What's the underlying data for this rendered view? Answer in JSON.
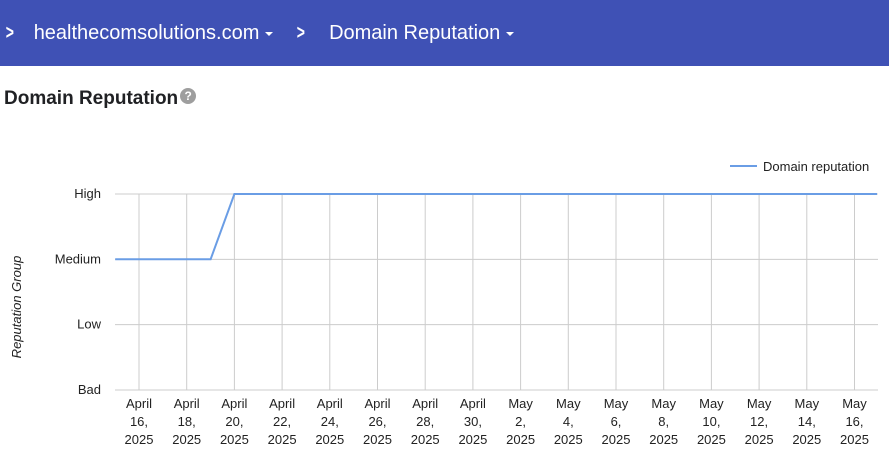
{
  "breadcrumb": {
    "domain": "healthecomsolutions.com",
    "section": "Domain Reputation"
  },
  "page": {
    "title": "Domain Reputation",
    "help_glyph": "?"
  },
  "icons": {
    "breadcrumb_separator": "chevron-right-icon",
    "dropdown": "caret-down-icon",
    "help": "help-icon"
  },
  "colors": {
    "header_bg": "#3f51b5",
    "series_line": "#6a9de5"
  },
  "chart_data": {
    "type": "line",
    "ylabel": "Reputation Group",
    "xlabel": "",
    "y_categories": [
      "Bad",
      "Low",
      "Medium",
      "High"
    ],
    "x_ticks": [
      [
        "April",
        "16,",
        "2025"
      ],
      [
        "April",
        "18,",
        "2025"
      ],
      [
        "April",
        "20,",
        "2025"
      ],
      [
        "April",
        "22,",
        "2025"
      ],
      [
        "April",
        "24,",
        "2025"
      ],
      [
        "April",
        "26,",
        "2025"
      ],
      [
        "April",
        "28,",
        "2025"
      ],
      [
        "April",
        "30,",
        "2025"
      ],
      [
        "May",
        "2,",
        "2025"
      ],
      [
        "May",
        "4,",
        "2025"
      ],
      [
        "May",
        "6,",
        "2025"
      ],
      [
        "May",
        "8,",
        "2025"
      ],
      [
        "May",
        "10,",
        "2025"
      ],
      [
        "May",
        "12,",
        "2025"
      ],
      [
        "May",
        "14,",
        "2025"
      ],
      [
        "May",
        "16,",
        "2025"
      ]
    ],
    "legend": {
      "position": "top-right"
    },
    "grid": true,
    "series": [
      {
        "name": "Domain reputation",
        "points": [
          {
            "x": "2025-04-15",
            "y": "Medium"
          },
          {
            "x": "2025-04-19",
            "y": "Medium"
          },
          {
            "x": "2025-04-20",
            "y": "High"
          },
          {
            "x": "2025-05-17",
            "y": "High"
          }
        ]
      }
    ]
  }
}
